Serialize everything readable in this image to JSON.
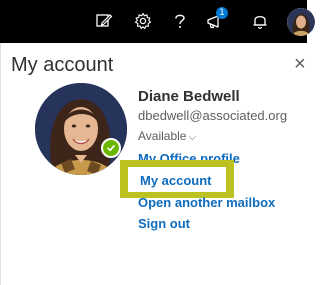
{
  "topbar": {
    "icons": [
      "edit-icon",
      "gear-icon",
      "help-icon",
      "megaphone-icon",
      "bell-icon",
      "profile-avatar"
    ],
    "notification_count": "1",
    "colors": {
      "background": "#000000",
      "badge": "#0078d4"
    }
  },
  "panel": {
    "title": "My account",
    "close_symbol": "×"
  },
  "user": {
    "name": "Diane Bedwell",
    "email": "dbedwell@associated.org",
    "status": "Available",
    "presence_color": "#6bb700"
  },
  "links": {
    "profile": "My Office profile",
    "account": "My account",
    "mailbox": "Open another mailbox",
    "signout": "Sign out",
    "color": "#0f6cbd"
  },
  "highlight_color": "#bcc21f"
}
